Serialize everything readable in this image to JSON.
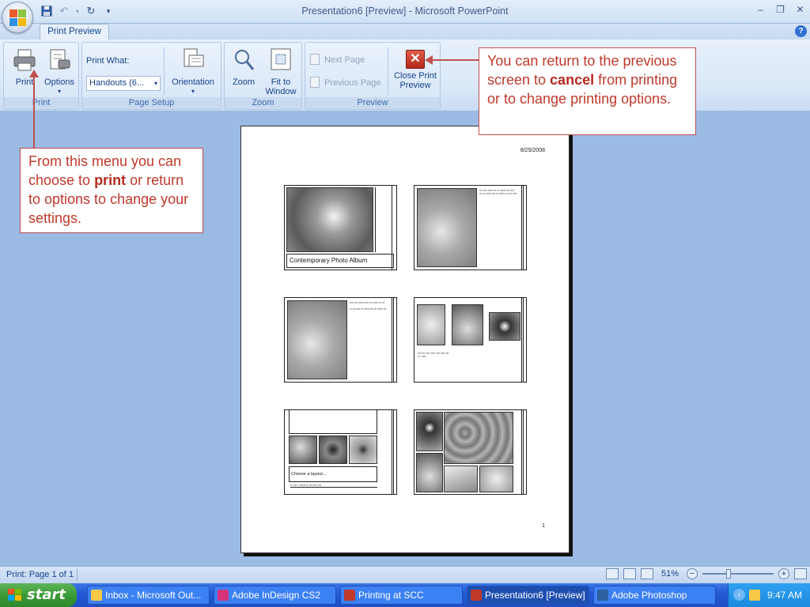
{
  "window": {
    "title": "Presentation6 [Preview] - Microsoft PowerPoint"
  },
  "ribbon": {
    "tab": "Print Preview",
    "groups": {
      "print": {
        "label": "Print",
        "print_btn": "Print",
        "options_btn": "Options"
      },
      "page_setup": {
        "label": "Page Setup",
        "print_what_label": "Print What:",
        "print_what_value": "Handouts (6...",
        "orientation_btn": "Orientation"
      },
      "zoom": {
        "label": "Zoom",
        "zoom_btn": "Zoom",
        "fit_btn_line1": "Fit to",
        "fit_btn_line2": "Window"
      },
      "preview": {
        "label": "Preview",
        "next_page": "Next Page",
        "previous_page": "Previous Page",
        "close_line1": "Close Print",
        "close_line2": "Preview"
      }
    }
  },
  "page": {
    "date": "8/25/2008",
    "number": "1",
    "slide1_caption": "Contemporary Photo Album",
    "slide5_caption": "Choose a layout..."
  },
  "callouts": {
    "left": {
      "p1": "From this menu you can choose to ",
      "bold": "print",
      "p2": " or return to options to change your settings."
    },
    "right": {
      "p1": "You can return to the previous screen to ",
      "bold": "cancel",
      "p2": " from printing or to change printing options."
    }
  },
  "status": {
    "page": "Print: Page 1 of 1",
    "zoom": "51%"
  },
  "taskbar": {
    "start": "start",
    "tasks": [
      "Inbox - Microsoft Out...",
      "Adobe InDesign CS2",
      "Printing at SCC",
      "Presentation6 [Preview]",
      "Adobe Photoshop"
    ],
    "time": "9:47 AM"
  },
  "colors": {
    "accent": "#c0504d",
    "ribbon_text": "#15428b",
    "taskbar": "#245bd6"
  }
}
